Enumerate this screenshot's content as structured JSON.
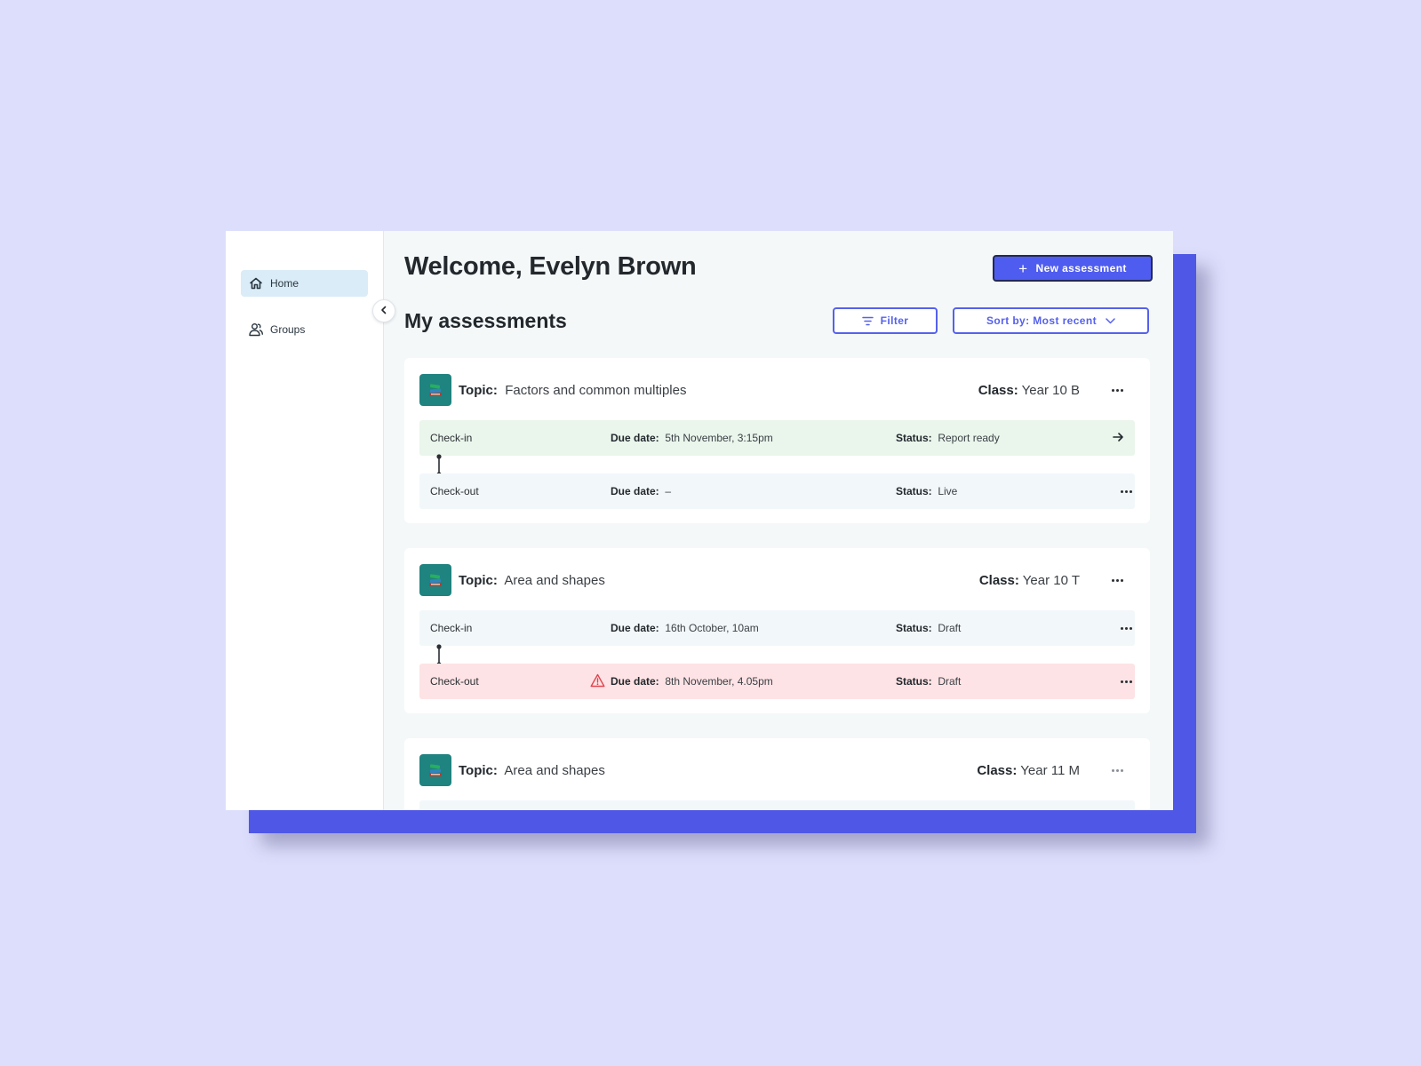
{
  "sidebar": {
    "items": [
      {
        "label": "Home",
        "icon": "home-icon",
        "active": true
      },
      {
        "label": "Groups",
        "icon": "groups-icon",
        "active": false
      }
    ]
  },
  "header": {
    "welcome": "Welcome, Evelyn Brown",
    "new_button_label": "New assessment",
    "section_title": "My assessments",
    "filter_label": "Filter",
    "sort_label": "Sort by: Most recent"
  },
  "labels": {
    "topic": "Topic:",
    "class": "Class:",
    "due_date": "Due date:",
    "status": "Status:"
  },
  "assessments": [
    {
      "topic": "Factors and common multiples",
      "class": "Year 10 B",
      "checkin": {
        "label": "Check-in",
        "due": "5th November, 3:15pm",
        "status": "Report ready"
      },
      "checkout": {
        "label": "Check-out",
        "due": "–",
        "status": "Live"
      }
    },
    {
      "topic": "Area and shapes",
      "class": "Year 10 T",
      "checkin": {
        "label": "Check-in",
        "due": "16th October, 10am",
        "status": "Draft"
      },
      "checkout": {
        "label": "Check-out",
        "due": "8th November, 4.05pm",
        "status": "Draft"
      }
    },
    {
      "topic": "Area and shapes",
      "class": "Year 11 M"
    }
  ],
  "colors": {
    "accent": "#4f5cf0",
    "background": "#dddefc",
    "backdrop": "#4f57e6",
    "topic_icon_bg": "#1f8380",
    "row_ready": "#eaf5ec",
    "row_default": "#f2f7fa",
    "row_overdue": "#fde3e5",
    "warning": "#e0454f"
  }
}
